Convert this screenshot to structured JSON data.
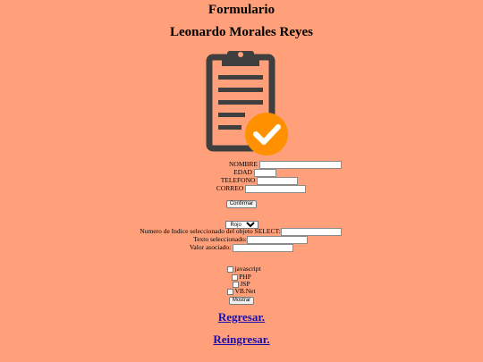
{
  "header": {
    "title": "Formulario",
    "author": "Leonardo Morales Reyes"
  },
  "icon": {
    "name": "clipboard-check-icon",
    "dark": "#3f3f3f",
    "accent": "#ff9100"
  },
  "form": {
    "nombre_label": "NOMBRE",
    "edad_label": "EDAD",
    "telefono_label": "TELEFONO",
    "correo_label": "CORREO",
    "confirm_label": "Confirmar"
  },
  "select_section": {
    "selected_option": "Rojo",
    "index_label": "Numero de Indice seleccionado del objeto SELECT:",
    "text_label": "Texto seleccionado:",
    "value_label": "Valor asociado:"
  },
  "checkboxes": {
    "items": [
      "javascript",
      "PHP",
      "JSP",
      "VB.Net"
    ],
    "show_label": "Mostrar"
  },
  "links": {
    "back": "Regresar.",
    "reenter": "Reingresar."
  }
}
